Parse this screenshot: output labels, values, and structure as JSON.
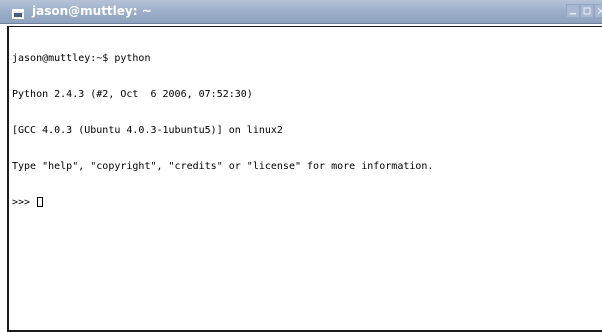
{
  "window": {
    "title": "jason@muttley: ~",
    "icon": "terminal-icon",
    "buttons": [
      "minimize-icon",
      "maximize-icon",
      "close-icon"
    ]
  },
  "terminal": {
    "lines": [
      "jason@muttley:~$ python",
      "Python 2.4.3 (#2, Oct  6 2006, 07:52:30)",
      "[GCC 4.0.3 (Ubuntu 4.0.3-1ubuntu5)] on linux2",
      "Type \"help\", \"copyright\", \"credits\" or \"license\" for more information."
    ],
    "prompt": ">>> "
  },
  "colors": {
    "titlebar": "#9eb0c9",
    "title_text": "#ffffff",
    "terminal_bg": "#ffffff",
    "terminal_fg": "#000000"
  }
}
